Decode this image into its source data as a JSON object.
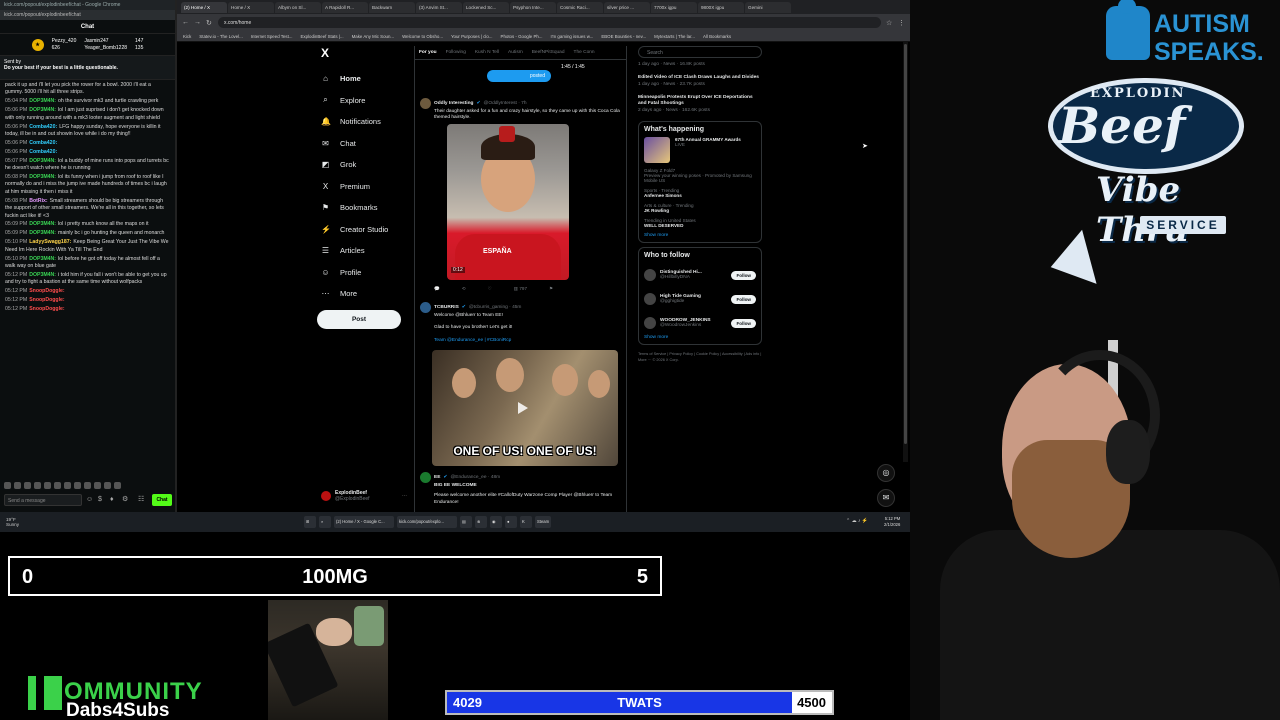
{
  "chat_window": {
    "title": "kick.com/popout/explodinbeef/chat - Google Chrome",
    "url": "kick.com/popout/explodinbeef/chat",
    "header": "Chat",
    "top_gifters": [
      {
        "name": "Pezzy_420",
        "count": "626"
      },
      {
        "name": "Jasmin247",
        "count": "147"
      },
      {
        "name": "Yeager_Bomb1228",
        "count": "135"
      }
    ],
    "pinned_line1": "Sent by",
    "pinned_line2": "Do your best if your best is a little questionable.",
    "messages": [
      {
        "time": "",
        "user": "",
        "cls": "",
        "text": "pack it up and i'll let you pick the rower for a bowl. 2000 i'll eat a gummy. 5000 i'll hit all three strips."
      },
      {
        "time": "05:04 PM",
        "user": "DOP3M4N:",
        "cls": "u-dop",
        "text": "oh the survivor mk3 and turtle crawling perk"
      },
      {
        "time": "05:06 PM",
        "user": "DOP3M4N:",
        "cls": "u-dop",
        "text": "lol I am just suprised i don't get knocked down with only running around with a mk3 looter augment and light shield"
      },
      {
        "time": "05:06 PM",
        "user": "Comba420:",
        "cls": "u-comba",
        "text": "LFG happy sunday, hope everyone is killin it today, ill be in and out showin love while i do my thing!!"
      },
      {
        "time": "05:06 PM",
        "user": "Comba420:",
        "cls": "u-comba",
        "text": ""
      },
      {
        "time": "05:06 PM",
        "user": "Comba420:",
        "cls": "u-comba",
        "text": ""
      },
      {
        "time": "05:07 PM",
        "user": "DOP3M4N:",
        "cls": "u-dop",
        "text": "lol a buddy of mine runs into pops and turrets bc he doesn't watch where he is running"
      },
      {
        "time": "05:08 PM",
        "user": "DOP3M4N:",
        "cls": "u-dop",
        "text": "lol its funny when i jump from roof to roof like I normally do and i miss the jump ive made hundreds of times bc i laugh at him missing it then i miss it"
      },
      {
        "time": "05:08 PM",
        "user": "BotRix:",
        "cls": "u-bot",
        "text": "Small streamers should be big streamers through the support of other small streamers. We're all in this together, so lets fuckin act like it! <3"
      },
      {
        "time": "05:09 PM",
        "user": "DOP3M4N:",
        "cls": "u-dop",
        "text": "lol i pretty much know all the maps on it"
      },
      {
        "time": "05:09 PM",
        "user": "DOP3M4N:",
        "cls": "u-dop",
        "text": "mainly bc i go hunting the queen and monarch"
      },
      {
        "time": "05:10 PM",
        "user": "LadyySwagg187:",
        "cls": "u-lady",
        "text": "Keep Being Great Your Just The Vibe We Need Im Here Rockin With Ya Till The End"
      },
      {
        "time": "05:10 PM",
        "user": "DOP3M4N:",
        "cls": "u-dop",
        "text": "lol before he got off today he almost fell off a walk way on blue gate"
      },
      {
        "time": "05:12 PM",
        "user": "DOP3M4N:",
        "cls": "u-dop",
        "text": "i told him if you fall i won't be able to get you up and try to fight a bastion at the same time without wolfpacks"
      },
      {
        "time": "05:12 PM",
        "user": "SnoopDoggle:",
        "cls": "u-snoop",
        "text": ""
      },
      {
        "time": "05:12 PM",
        "user": "SnoopDoggle:",
        "cls": "u-snoop",
        "text": ""
      },
      {
        "time": "05:12 PM",
        "user": "SnoopDoggle:",
        "cls": "u-snoop",
        "text": ""
      }
    ],
    "input_placeholder": "Send a message",
    "send_label": "Chat"
  },
  "browser": {
    "tabs": [
      {
        "label": "(2) Home / X",
        "active": true
      },
      {
        "label": "Home / X",
        "active": false
      },
      {
        "label": "Albym on Sl...",
        "active": false
      },
      {
        "label": "A Rapidoll R...",
        "active": false
      },
      {
        "label": "Backwarn",
        "active": false
      },
      {
        "label": "(3) Anvim St...",
        "active": false
      },
      {
        "label": "Lockened Sc...",
        "active": false
      },
      {
        "label": "Psyphon Inte...",
        "active": false
      },
      {
        "label": "Cosmic Raci...",
        "active": false
      },
      {
        "label": "silver price ...",
        "active": false
      },
      {
        "label": "7700x igpu",
        "active": false
      },
      {
        "label": "9800X igpu",
        "active": false
      },
      {
        "label": "Gemini",
        "active": false
      }
    ],
    "url": "x.com/home",
    "bookmarks": [
      "Kick",
      "Statev.io - The Lovel...",
      "Internet Speed Test...",
      "ExplodinBeef Stats |...",
      "Make Any Mic Soun...",
      "Welcome to Obsho...",
      "Your Purposes | clo...",
      "Photos - Google Ph...",
      "I'm gaming issues w...",
      "EBOE Bounties - nev...",
      "Mytextarts | The lar...",
      "All Bookmarks"
    ]
  },
  "x": {
    "logo": "X",
    "nav": [
      {
        "icon": "⌂",
        "name": "home-icon",
        "label": "Home"
      },
      {
        "icon": "⌕",
        "name": "search-icon",
        "label": "Explore"
      },
      {
        "icon": "🔔",
        "name": "bell-icon",
        "label": "Notifications"
      },
      {
        "icon": "✉",
        "name": "chat-icon",
        "label": "Chat"
      },
      {
        "icon": "◩",
        "name": "grok-icon",
        "label": "Grok"
      },
      {
        "icon": "X",
        "name": "premium-icon",
        "label": "Premium"
      },
      {
        "icon": "⚑",
        "name": "bookmark-icon",
        "label": "Bookmarks"
      },
      {
        "icon": "⚡",
        "name": "creator-studio-icon",
        "label": "Creator Studio"
      },
      {
        "icon": "☰",
        "name": "articles-icon",
        "label": "Articles"
      },
      {
        "icon": "☺",
        "name": "profile-icon",
        "label": "Profile"
      },
      {
        "icon": "⋯",
        "name": "more-icon",
        "label": "More"
      }
    ],
    "post_label": "Post",
    "profile": {
      "name": "ExplodinBeef",
      "handle": "@ExplodinBeef"
    },
    "feed_tabs": [
      "For you",
      "Following",
      "Kush N Tell",
      "Autism",
      "BeefNPitSquad",
      "The Conn"
    ],
    "posted_label": "posted",
    "video_time": "1:45 / 1:45",
    "tweet1": {
      "name": "Oddly Interesting",
      "handle": "@OddlyInterest · 7h",
      "text": "Their daughter asked for a fun and crazy hairstyle, so they came up with this Coca Cola themed hairstyle.",
      "media_duration": "0:12",
      "shirt_text": "ESPAÑA",
      "actions": [
        "",
        "",
        "",
        "797"
      ]
    },
    "tweet2": {
      "name": "TCBURRIS",
      "handle": "@tcburris_gaming · 45m",
      "line1": "Welcome @Bhluerr to Team EE!",
      "line2": "Glad to have you brother! Let's get it!",
      "line3": "Team @Endurance_ee | #CBoniRcp",
      "caption": "ONE OF US! ONE OF US!"
    },
    "tweet3": {
      "name": "EE",
      "handle": "@Endurance_ee · 48m",
      "line1": "BIG EE WELCOME",
      "line2": "Please welcome another elite #CallofDuty Warzone Comp Player @Bhluerr to Team Endurance!"
    },
    "search_placeholder": "Search",
    "news": [
      {
        "title": "",
        "meta": "1 day ago · News · 16.8K posts"
      },
      {
        "title": "Edited Video of ICE Clash Draws Laughs and Divides",
        "meta": "1 day ago · News · 23.7K posts"
      },
      {
        "title": "Minneapolis Protests Erupt Over ICE Deportations and Fatal Shootings",
        "meta": "2 days ago · News · 162.6K posts"
      }
    ],
    "whats_happening": {
      "title": "What's happening",
      "event": {
        "name": "67th Annual GRAMMY Awards",
        "meta": "LIVE"
      },
      "trends": [
        {
          "ctx": "Galaxy Z Fold7",
          "name": "",
          "meta": "Preview your winning poses · Promoted by Samsung Mobile US"
        },
        {
          "ctx": "Sports · Trending",
          "name": "Anfernee Simons",
          "meta": ""
        },
        {
          "ctx": "Arts & culture · Trending",
          "name": "JK Rowling",
          "meta": ""
        },
        {
          "ctx": "Trending in United States",
          "name": "WELL DESERVED",
          "meta": ""
        }
      ],
      "show_more": "Show more"
    },
    "who_to_follow": {
      "title": "Who to follow",
      "accounts": [
        {
          "name": "Distinguished Hi...",
          "handle": "@HillbillyDNA"
        },
        {
          "name": "High Tide Gaming",
          "handle": "@gghigtide"
        },
        {
          "name": "WOODROW_JENKINS",
          "handle": "@WoodrowJenkins"
        }
      ],
      "follow_label": "Follow",
      "show_more": "Show more"
    },
    "footer": "Terms of Service | Privacy Policy | Cookie Policy | Accessibility | Ads info | More ··· © 2026 X Corp."
  },
  "taskbar": {
    "weather_temp": "19°F",
    "weather_text": "Sunny",
    "apps": [
      "(2) Home / X - Google C...",
      "kick.com/popout/explo...",
      "Steam"
    ],
    "time": "5:12 PM",
    "date": "2/1/2026"
  },
  "scoreboard": {
    "left": "0",
    "title": "100MG",
    "right": "5"
  },
  "community": {
    "word": "OMMUNITY",
    "sub": "Dabs4Subs"
  },
  "goal": {
    "current": "4029",
    "label": "TWATS",
    "target": "4500",
    "progress": 0.895,
    "fill_color": "#1836e6"
  },
  "autism_logo": {
    "line1": "AUTISM",
    "line2": "SPEAKS."
  },
  "beef_logo": {
    "top": "EXPLODIN",
    "word": "Beef",
    "vibe": "Vibe Thru",
    "service": "SERVICE"
  }
}
